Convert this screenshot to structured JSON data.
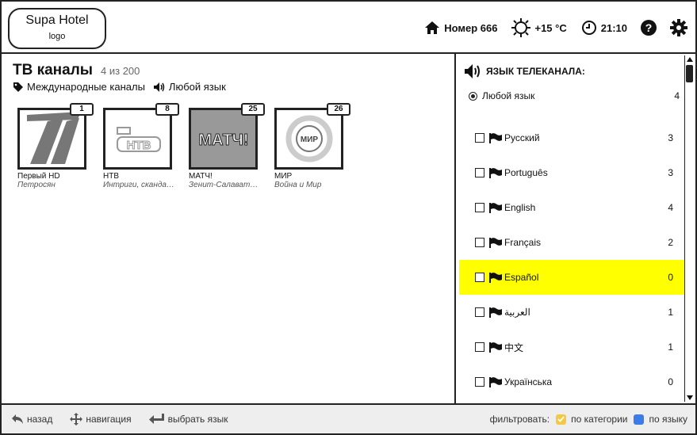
{
  "header": {
    "logo_title": "Supa Hotel",
    "logo_sub": "logo",
    "room": "Номер 666",
    "weather": "+15 °C",
    "time": "21:10",
    "icons": [
      "home-icon",
      "sun-icon",
      "clock-icon",
      "help-icon",
      "gear-icon"
    ]
  },
  "main": {
    "title": "ТВ каналы",
    "count": "4 из 200",
    "filter_category": "Международные каналы",
    "filter_language": "Любой язык",
    "channels": [
      {
        "number": "1",
        "name": "Первый HD",
        "program": "Петросян"
      },
      {
        "number": "8",
        "name": "НТВ",
        "program": "Интриги, скандалы"
      },
      {
        "number": "25",
        "name": "МАТЧ!",
        "program": "Зенит-Салават Юлаев"
      },
      {
        "number": "26",
        "name": "МИР",
        "program": "Война и Мир"
      }
    ],
    "logo_texts": [
      "НТВ",
      "МАТЧ!",
      "МИР"
    ]
  },
  "panel": {
    "heading": "ЯЗЫК ТЕЛЕКАНАЛА:",
    "any_label": "Любой язык",
    "any_count": "4",
    "languages": [
      {
        "label": "Русский",
        "count": "3"
      },
      {
        "label": "Português",
        "count": "3"
      },
      {
        "label": "English",
        "count": "4"
      },
      {
        "label": "Français",
        "count": "2"
      },
      {
        "label": "Español",
        "count": "0"
      },
      {
        "label": "العربية",
        "count": "1"
      },
      {
        "label": "中文",
        "count": "1"
      },
      {
        "label": "Українська",
        "count": "0"
      }
    ],
    "selected_index": 4,
    "highlight_color": "#ffff00"
  },
  "footer": {
    "back": "назад",
    "navigate": "навигация",
    "select": "выбрать язык",
    "filter_label": "фильтровать:",
    "by_category": "по категории",
    "by_language": "по языку",
    "category_color": "#f5c842",
    "language_color": "#3b7de8"
  }
}
